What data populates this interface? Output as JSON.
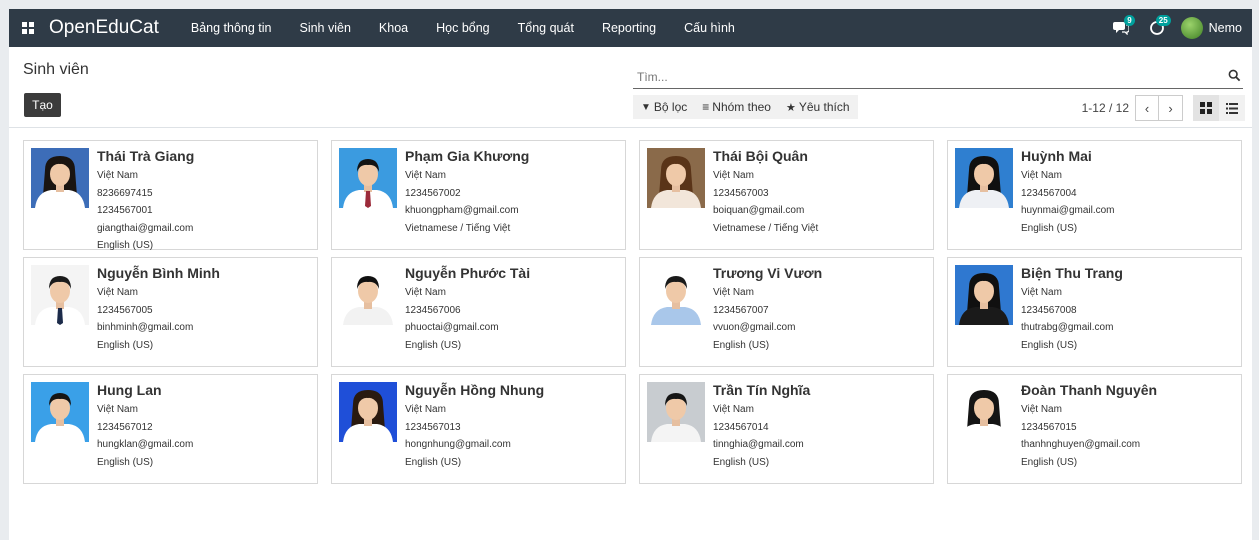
{
  "navbar": {
    "brand": "OpenEduCat",
    "menu": [
      "Bảng thông tin",
      "Sinh viên",
      "Khoa",
      "Học bổng",
      "Tổng quát",
      "Reporting",
      "Cấu hình"
    ],
    "messages_badge": "9",
    "activity_badge": "25",
    "user_name": "Nemo",
    "icons": [
      "apps-grid-icon",
      "chat-icon",
      "clock-icon",
      "user-avatar"
    ]
  },
  "control": {
    "page_title": "Sinh viên",
    "create_label": "Tạo",
    "search_placeholder": "Tìm...",
    "filters": [
      {
        "label": "Bộ lọc",
        "icon": "funnel-icon"
      },
      {
        "label": "Nhóm theo",
        "icon": "bars-icon"
      },
      {
        "label": "Yêu thích",
        "icon": "star-icon"
      }
    ],
    "pager": "1-12 / 12"
  },
  "students": [
    {
      "name": "Thái Trà Giang",
      "lines": [
        "Việt Nam",
        "8236697415",
        "1234567001",
        "giangthai@gmail.com",
        "English (US)"
      ],
      "bg": "#3d6db8",
      "shirt": "#ffffff",
      "hair": "#1a1410",
      "long_hair": true
    },
    {
      "name": "Phạm Gia Khương",
      "lines": [
        "Việt Nam",
        "1234567002",
        "khuongpham@gmail.com",
        "Vietnamese / Tiếng Việt"
      ],
      "bg": "#3b9be0",
      "shirt": "#ffffff",
      "hair": "#141414",
      "long_hair": false,
      "tie": "#9c2b3a"
    },
    {
      "name": "Thái Bội Quân",
      "lines": [
        "Việt Nam",
        "1234567003",
        "boiquan@gmail.com",
        "Vietnamese / Tiếng Việt"
      ],
      "bg": "#8a6a4a",
      "shirt": "#f2e6da",
      "hair": "#5a3418",
      "long_hair": true
    },
    {
      "name": "Huỳnh Mai",
      "lines": [
        "Việt Nam",
        "1234567004",
        "huynmai@gmail.com",
        "English (US)"
      ],
      "bg": "#2f7fd0",
      "shirt": "#eef0f4",
      "hair": "#101010",
      "long_hair": true
    },
    {
      "name": "Nguyễn Bình Minh",
      "lines": [
        "Việt Nam",
        "1234567005",
        "binhminh@gmail.com",
        "English (US)"
      ],
      "bg": "#f4f4f4",
      "shirt": "#ffffff",
      "hair": "#1a1a1a",
      "long_hair": false,
      "tie": "#1c2b4a"
    },
    {
      "name": "Nguyễn Phước Tài",
      "lines": [
        "Việt Nam",
        "1234567006",
        "phuoctai@gmail.com",
        "English (US)"
      ],
      "bg": "#ffffff",
      "shirt": "#f2f2f2",
      "hair": "#101010",
      "long_hair": false
    },
    {
      "name": "Trương Vi Vươn",
      "lines": [
        "Việt Nam",
        "1234567007",
        "vvuon@gmail.com",
        "English (US)"
      ],
      "bg": "#ffffff",
      "shirt": "#a9c7ea",
      "hair": "#1a1a1a",
      "long_hair": false
    },
    {
      "name": "Biện Thu Trang",
      "lines": [
        "Việt Nam",
        "1234567008",
        "thutrabg@gmail.com",
        "English (US)"
      ],
      "bg": "#2f78d0",
      "shirt": "#1a1a1a",
      "hair": "#101010",
      "long_hair": true
    },
    {
      "name": "Hung Lan",
      "lines": [
        "Việt Nam",
        "1234567012",
        "hungklan@gmail.com",
        "English (US)"
      ],
      "bg": "#3aa0e8",
      "shirt": "#ffffff",
      "hair": "#151515",
      "long_hair": false
    },
    {
      "name": "Nguyễn Hồng Nhung",
      "lines": [
        "Việt Nam",
        "1234567013",
        "hongnhung@gmail.com",
        "English (US)"
      ],
      "bg": "#1f4fd8",
      "shirt": "#ffffff",
      "hair": "#2a1a10",
      "long_hair": true
    },
    {
      "name": "Trần Tín Nghĩa",
      "lines": [
        "Việt Nam",
        "1234567014",
        "tinnghia@gmail.com",
        "English (US)"
      ],
      "bg": "#c8ccd0",
      "shirt": "#f4f4f4",
      "hair": "#151515",
      "long_hair": false
    },
    {
      "name": "Đoàn Thanh Nguyên",
      "lines": [
        "Việt Nam",
        "1234567015",
        "thanhnghuyen@gmail.com",
        "English (US)"
      ],
      "bg": "#ffffff",
      "shirt": "#ffffff",
      "hair": "#141414",
      "long_hair": true
    }
  ]
}
